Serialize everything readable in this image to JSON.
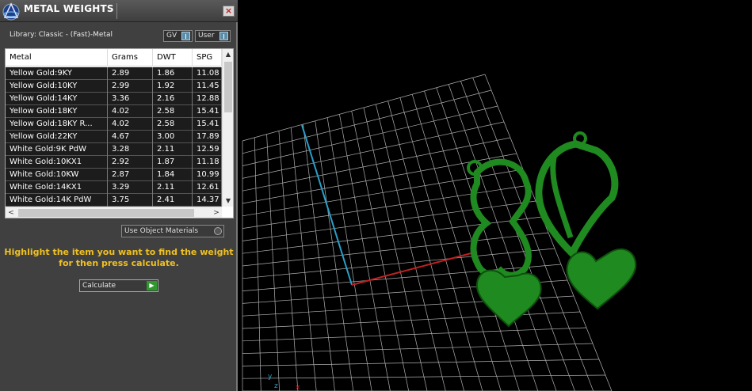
{
  "panel": {
    "title": "METAL WEIGHTS",
    "close_glyph": "×",
    "library_label": "Library: Classic - (Fast)-Metal",
    "toggles": {
      "gv": "GV",
      "user": "User"
    },
    "columns": [
      "Metal",
      "Grams",
      "DWT",
      "SPG"
    ],
    "rows": [
      [
        "Yellow Gold:9KY",
        "2.89",
        "1.86",
        "11.08"
      ],
      [
        "Yellow Gold:10KY",
        "2.99",
        "1.92",
        "11.45"
      ],
      [
        "Yellow Gold:14KY",
        "3.36",
        "2.16",
        "12.88"
      ],
      [
        "Yellow Gold:18KY",
        "4.02",
        "2.58",
        "15.41"
      ],
      [
        "Yellow Gold:18KY R...",
        "4.02",
        "2.58",
        "15.41"
      ],
      [
        "Yellow Gold:22KY",
        "4.67",
        "3.00",
        "17.89"
      ],
      [
        "White Gold:9K PdW",
        "3.28",
        "2.11",
        "12.59"
      ],
      [
        "White Gold:10KX1",
        "2.92",
        "1.87",
        "11.18"
      ],
      [
        "White Gold:10KW",
        "2.87",
        "1.84",
        "10.99"
      ],
      [
        "White Gold:14KX1",
        "3.29",
        "2.11",
        "12.61"
      ],
      [
        "White Gold:14K PdW",
        "3.75",
        "2.41",
        "14.37"
      ]
    ],
    "use_object_materials": "Use Object Materials",
    "instructions_line1": "Highlight the item you want to find the weight",
    "instructions_line2": "for then press calculate.",
    "calculate_label": "Calculate",
    "scroll_up": "▲",
    "scroll_down": "▼",
    "scroll_left": "<",
    "scroll_right": ">",
    "go_glyph": "▶"
  },
  "viewport": {
    "grid_color": "#cfcfcf",
    "axis_y_color": "#2aa0c8",
    "axis_x_color": "#c02020",
    "model_color": "#1f8a1f",
    "model_icons": [
      "rose-pendant-icon",
      "heart-earring-icon"
    ],
    "gizmo_label_y": "y",
    "gizmo_label_z": "z"
  }
}
